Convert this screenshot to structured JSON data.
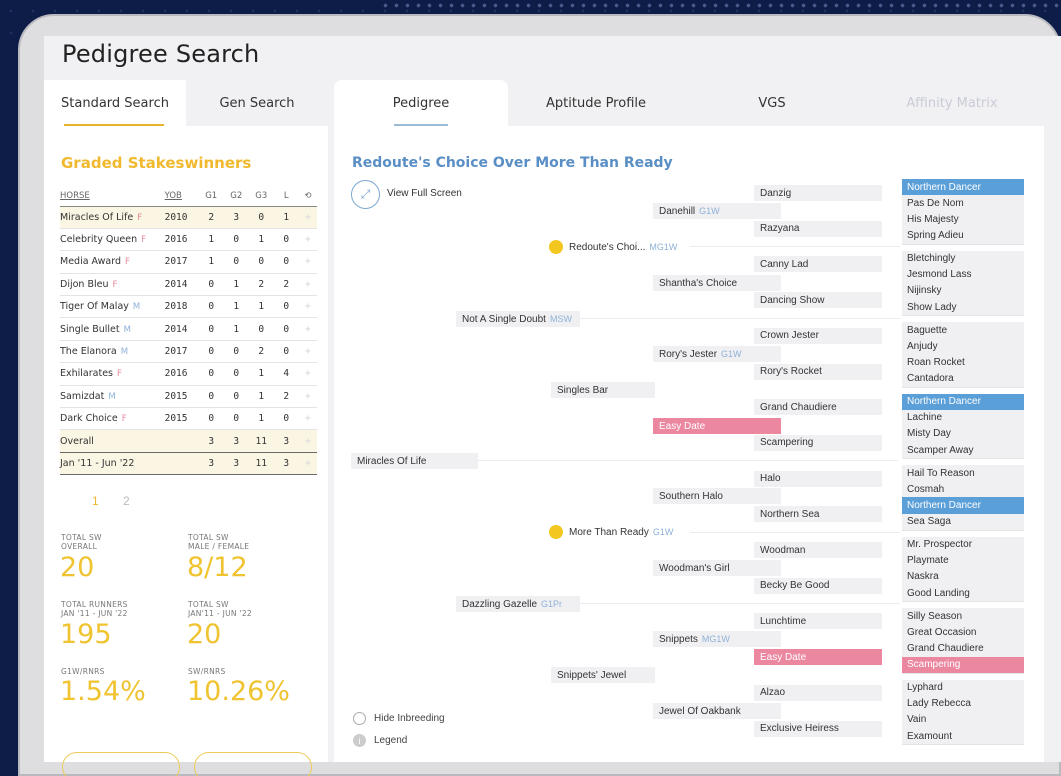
{
  "app": {
    "title": "Pedigree Search"
  },
  "left_tabs": [
    {
      "label": "Standard Search",
      "active": true
    },
    {
      "label": "Gen Search",
      "active": false
    }
  ],
  "right_tabs": [
    {
      "label": "Pedigree",
      "active": true
    },
    {
      "label": "Aptitude Profile",
      "active": false
    },
    {
      "label": "VGS",
      "active": false
    },
    {
      "label": "Affinity Matrix",
      "active": false,
      "disabled": true
    }
  ],
  "graded": {
    "title": "Graded Stakeswinners",
    "columns": [
      "HORSE",
      "YOB",
      "G1",
      "G2",
      "G3",
      "L"
    ],
    "rows": [
      {
        "horse": "Miracles Of Life",
        "sex": "F",
        "yob": "2010",
        "g1": "2",
        "g2": "3",
        "g3": "0",
        "l": "1"
      },
      {
        "horse": "Celebrity Queen",
        "sex": "F",
        "yob": "2016",
        "g1": "1",
        "g2": "0",
        "g3": "1",
        "l": "0"
      },
      {
        "horse": "Media Award",
        "sex": "F",
        "yob": "2017",
        "g1": "1",
        "g2": "0",
        "g3": "0",
        "l": "0"
      },
      {
        "horse": "Dijon Bleu",
        "sex": "F",
        "yob": "2014",
        "g1": "0",
        "g2": "1",
        "g3": "2",
        "l": "2"
      },
      {
        "horse": "Tiger Of Malay",
        "sex": "M",
        "yob": "2018",
        "g1": "0",
        "g2": "1",
        "g3": "1",
        "l": "0"
      },
      {
        "horse": "Single Bullet",
        "sex": "M",
        "yob": "2014",
        "g1": "0",
        "g2": "1",
        "g3": "0",
        "l": "0"
      },
      {
        "horse": "The Elanora",
        "sex": "M",
        "yob": "2017",
        "g1": "0",
        "g2": "0",
        "g3": "2",
        "l": "0"
      },
      {
        "horse": "Exhilarates",
        "sex": "F",
        "yob": "2016",
        "g1": "0",
        "g2": "0",
        "g3": "1",
        "l": "4"
      },
      {
        "horse": "Samizdat",
        "sex": "M",
        "yob": "2015",
        "g1": "0",
        "g2": "0",
        "g3": "1",
        "l": "2"
      },
      {
        "horse": "Dark Choice",
        "sex": "F",
        "yob": "2015",
        "g1": "0",
        "g2": "0",
        "g3": "1",
        "l": "0"
      }
    ],
    "summary": [
      {
        "label": "Overall",
        "g1": "3",
        "g2": "3",
        "g3": "11",
        "l": "3"
      },
      {
        "label": "Jan '11 - Jun '22",
        "g1": "3",
        "g2": "3",
        "g3": "11",
        "l": "3"
      }
    ],
    "pages": [
      "1",
      "2"
    ],
    "plus_glyph": "+",
    "reset_glyph": "⟲"
  },
  "stats": {
    "total_sw_overall_label": [
      "TOTAL SW",
      "OVERALL"
    ],
    "total_sw_overall": "20",
    "total_sw_mf_label": [
      "TOTAL SW",
      "MALE / FEMALE"
    ],
    "total_sw_mf": "8/12",
    "total_runners_label": [
      "TOTAL RUNNERS",
      "JAN '11 - JUN '22"
    ],
    "total_runners": "195",
    "total_sw_period_label": [
      "TOTAL SW",
      "JAN'11 - JUN '22"
    ],
    "total_sw_period": "20",
    "g1w_rnrs_label": "G1W/RNRS",
    "g1w_rnrs": "1.54%",
    "sw_rnrs_label": "SW/RNRS",
    "sw_rnrs": "10.26%"
  },
  "pedigree": {
    "title": "Redoute's Choice Over More Than Ready",
    "view_full_screen": "View Full Screen",
    "subject": "Miracles Of Life",
    "sire": {
      "name": "Redoute's Choi...",
      "tag": "MG1W"
    },
    "dam": {
      "name": "More Than Ready",
      "tag": "G1W"
    },
    "gen3": [
      {
        "name": "Danehill",
        "tag": "G1W"
      },
      {
        "name": "Shantha's Choice",
        "tag": ""
      },
      {
        "name": "Rory's Jester",
        "tag": "G1W"
      },
      {
        "name": "Easy Date",
        "tag": ""
      },
      {
        "name": "Southern Halo",
        "tag": ""
      },
      {
        "name": "Woodman's Girl",
        "tag": ""
      },
      {
        "name": "Snippets",
        "tag": "MG1W"
      },
      {
        "name": "Jewel Of Oakbank",
        "tag": ""
      }
    ],
    "gen2b": [
      {
        "name": "Not A Single Doubt",
        "tag": "MSW"
      },
      {
        "name": "Singles Bar",
        "tag": ""
      },
      {
        "name": "Dazzling Gazelle",
        "tag": "G1Pr"
      },
      {
        "name": "Snippets' Jewel",
        "tag": ""
      }
    ],
    "gen4": [
      "Danzig",
      "Razyana",
      "Canny Lad",
      "Dancing Show",
      "Crown Jester",
      "Rory's Rocket",
      "Grand Chaudiere",
      "Scampering",
      "Halo",
      "Northern Sea",
      "Woodman",
      "Becky Be Good",
      "Lunchtime",
      "Easy Date",
      "Alzao",
      "Exclusive Heiress"
    ],
    "gen5": [
      "Northern Dancer",
      "Pas De Nom",
      "His Majesty",
      "Spring Adieu",
      "Bletchingly",
      "Jesmond Lass",
      "Nijinsky",
      "Show Lady",
      "Baguette",
      "Anjudy",
      "Roan Rocket",
      "Cantadora",
      "Northern Dancer",
      "Lachine",
      "Misty Day",
      "Scamper Away",
      "Hail To Reason",
      "Cosmah",
      "Northern Dancer",
      "Sea Saga",
      "Mr. Prospector",
      "Playmate",
      "Naskra",
      "Good Landing",
      "Silly Season",
      "Great Occasion",
      "Grand Chaudiere",
      "Scampering",
      "Lyphard",
      "Lady Rebecca",
      "Vain",
      "Examount"
    ],
    "hide_inbreeding": "Hide Inbreeding",
    "legend": "Legend"
  },
  "colors": {
    "accent_gold": "#f0b92e",
    "accent_blue": "#5a8fc6",
    "inbred_blue": "#5b9fd8",
    "inbred_pink": "#ec87a0"
  }
}
